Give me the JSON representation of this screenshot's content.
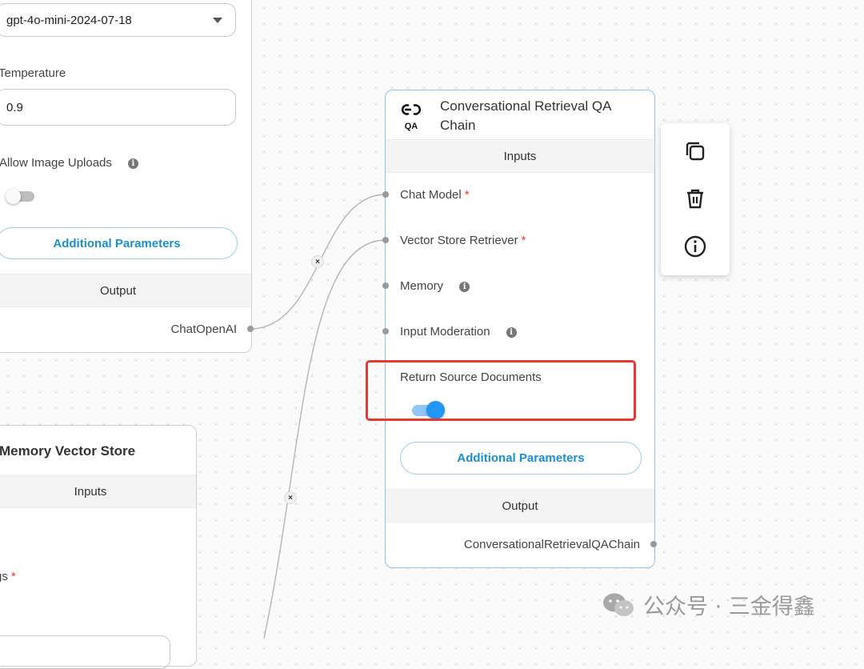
{
  "chat_openai_node": {
    "model_value": "gpt-4o-mini-2024-07-18",
    "temperature_label": "Temperature",
    "temperature_value": "0.9",
    "allow_image_uploads_label": "Allow Image Uploads",
    "additional_parameters_label": "Additional Parameters",
    "output_header": "Output",
    "output_label": "ChatOpenAI"
  },
  "memory_vector_store_node": {
    "title": "Memory Vector Store",
    "inputs_header": "Inputs",
    "partial_field_label": "gs"
  },
  "qa_chain_node": {
    "icon_text": "QA",
    "title": "Conversational Retrieval QA Chain",
    "inputs_header": "Inputs",
    "inputs": [
      {
        "label": "Chat Model"
      },
      {
        "label": "Vector Store Retriever"
      },
      {
        "label": "Memory"
      },
      {
        "label": "Input Moderation"
      }
    ],
    "return_source_documents_label": "Return Source Documents",
    "return_source_documents_enabled": true,
    "additional_parameters_label": "Additional Parameters",
    "output_header": "Output",
    "output_label": "ConversationalRetrievalQAChain"
  },
  "node_toolbar": {
    "icons": [
      "copy-icon",
      "trash-icon",
      "info-icon"
    ]
  },
  "watermark": {
    "text": "公众号 · 三金得鑫"
  },
  "colors": {
    "accent": "#1b8fd0",
    "toggle_on": "#2196f3",
    "highlight_box": "#e53935"
  }
}
